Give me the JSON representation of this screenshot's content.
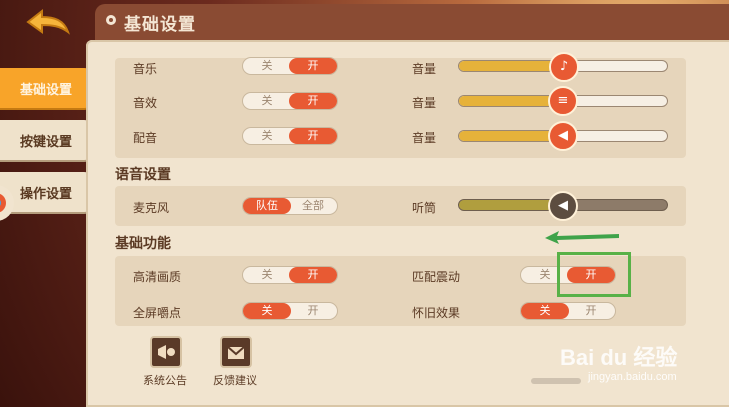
{
  "header": {
    "title": "基础设置"
  },
  "tabs": [
    {
      "label": "基础设置"
    },
    {
      "label": "按键设置"
    },
    {
      "label": "操作设置"
    }
  ],
  "sound": {
    "rows": [
      {
        "label": "音乐",
        "toggle_off": "关",
        "toggle_on": "开",
        "volume_label": "音量",
        "volume_pct": 50
      },
      {
        "label": "音效",
        "toggle_off": "关",
        "toggle_on": "开",
        "volume_label": "音量",
        "volume_pct": 50
      },
      {
        "label": "配音",
        "toggle_off": "关",
        "toggle_on": "开",
        "volume_label": "音量",
        "volume_pct": 50
      }
    ]
  },
  "voice": {
    "title": "语音设置",
    "mic_label": "麦克风",
    "mic_left": "队伍",
    "mic_right": "全部",
    "earpiece_label": "听筒",
    "earpiece_pct": 50
  },
  "basic": {
    "title": "基础功能",
    "rows": [
      {
        "label": "高清画质",
        "off": "关",
        "on": "开",
        "selected": "on"
      },
      {
        "label": "全屏嚼点",
        "off": "关",
        "on": "开",
        "selected": "off"
      },
      {
        "label": "匹配震动",
        "off": "关",
        "on": "开",
        "selected": "on"
      },
      {
        "label": "怀旧效果",
        "off": "关",
        "on": "开",
        "selected": "off"
      }
    ]
  },
  "footer": {
    "notice_label": "系统公告",
    "feedback_label": "反馈建议"
  },
  "watermark": {
    "main": "Bai du 经验",
    "sub": "jingyan.baidu.com"
  },
  "colors": {
    "accent": "#e85a33",
    "tab_active": "#f8a429",
    "highlight_box": "#58b147"
  }
}
